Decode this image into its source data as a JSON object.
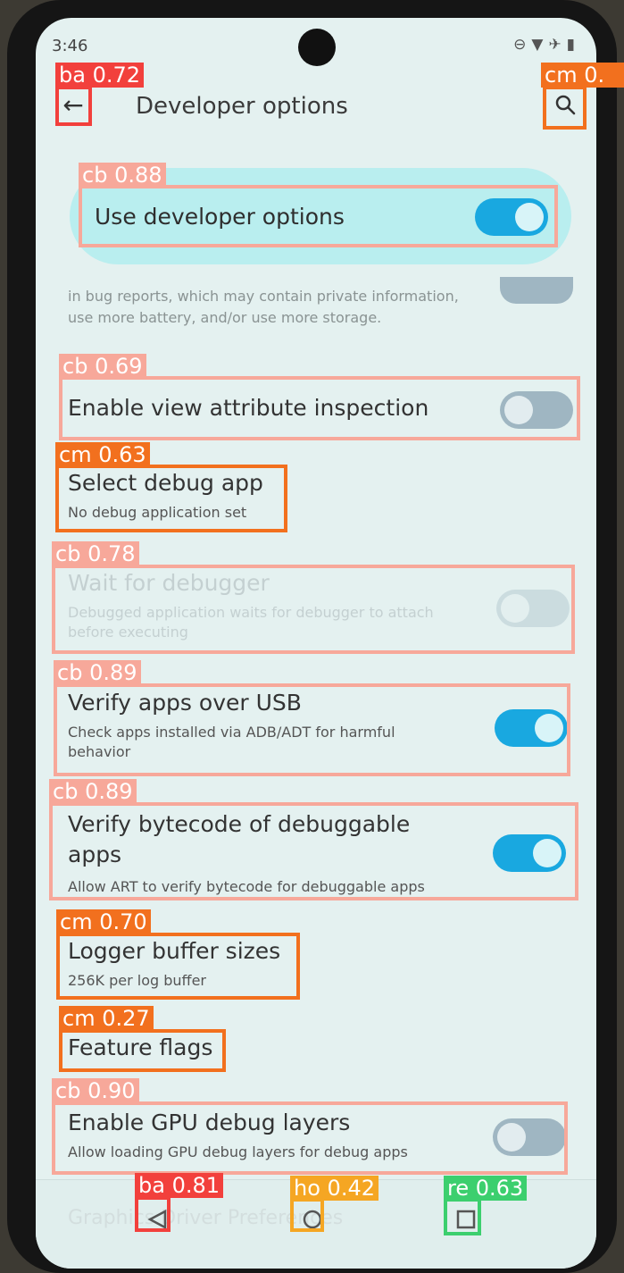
{
  "status_bar": {
    "time": "3:46"
  },
  "header": {
    "title": "Developer options"
  },
  "master_switch": {
    "label": "Use developer options",
    "on": true
  },
  "cut_off_text": "in bug reports, which may contain private information, use more battery, and/or use more storage.",
  "settings": [
    {
      "title": "Enable view attribute inspection",
      "summary": "",
      "toggle": "off"
    },
    {
      "title": "Select debug app",
      "summary": "No debug application set",
      "toggle": "none"
    },
    {
      "title": "Wait for debugger",
      "summary": "Debugged application waits for debugger to attach before executing",
      "toggle": "off",
      "disabled": true
    },
    {
      "title": "Verify apps over USB",
      "summary": "Check apps installed via ADB/ADT for harmful behavior",
      "toggle": "on"
    },
    {
      "title": "Verify bytecode of debuggable apps",
      "summary": "Allow ART to verify bytecode for debuggable apps",
      "toggle": "on"
    },
    {
      "title": "Logger buffer sizes",
      "summary": "256K per log buffer",
      "toggle": "none"
    },
    {
      "title": "Feature flags",
      "summary": "",
      "toggle": "none"
    },
    {
      "title": "Enable GPU debug layers",
      "summary": "Allow loading GPU debug layers for debug apps",
      "toggle": "off"
    }
  ],
  "nav_bar": {
    "ghost_text": "Graphics Driver Preferences"
  },
  "detections": [
    {
      "label": "ba",
      "score": "0.72",
      "color": "#f2403c"
    },
    {
      "label": "cm",
      "score": "0.",
      "color": "#f2701e"
    },
    {
      "label": "cb",
      "score": "0.88",
      "color": "#f7a89a"
    },
    {
      "label": "cb",
      "score": "0.69",
      "color": "#f7a89a"
    },
    {
      "label": "cm",
      "score": "0.63",
      "color": "#f2701e"
    },
    {
      "label": "cb",
      "score": "0.78",
      "color": "#f7a89a"
    },
    {
      "label": "cb",
      "score": "0.89",
      "color": "#f7a89a"
    },
    {
      "label": "cb",
      "score": "0.89",
      "color": "#f7a89a"
    },
    {
      "label": "cm",
      "score": "0.70",
      "color": "#f2701e"
    },
    {
      "label": "cm",
      "score": "0.27",
      "color": "#f2701e"
    },
    {
      "label": "cb",
      "score": "0.90",
      "color": "#f7a89a"
    },
    {
      "label": "ba",
      "score": "0.81",
      "color": "#f2403c"
    },
    {
      "label": "ho",
      "score": "0.42",
      "color": "#f5a623"
    },
    {
      "label": "re",
      "score": "0.63",
      "color": "#3ccf6e"
    }
  ]
}
